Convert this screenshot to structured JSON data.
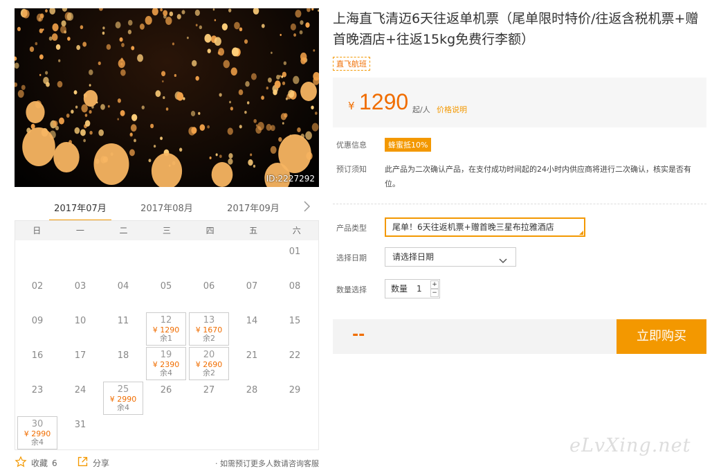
{
  "hero": {
    "id_label": "ID:2227292"
  },
  "calendar": {
    "months": [
      "2017年07月",
      "2017年08月",
      "2017年09月"
    ],
    "active_month": 0,
    "weekdays": [
      "日",
      "一",
      "二",
      "三",
      "四",
      "五",
      "六"
    ],
    "first_weekday": 6,
    "days_in_month": 31,
    "available": {
      "12": {
        "price": "¥ 1290",
        "remain": "余1"
      },
      "13": {
        "price": "¥ 1670",
        "remain": "余2"
      },
      "19": {
        "price": "¥ 2390",
        "remain": "余4"
      },
      "20": {
        "price": "¥ 2690",
        "remain": "余2"
      },
      "25": {
        "price": "¥ 2990",
        "remain": "余4"
      },
      "30": {
        "price": "¥ 2990",
        "remain": "余4"
      }
    }
  },
  "actions": {
    "favorite_label": "收藏",
    "favorite_count": "6",
    "share_label": "分享",
    "more_note": "· 如需预订更多人数请咨询客服"
  },
  "product": {
    "title": "上海直飞清迈6天往返单机票（尾单限时特价/往返含税机票+赠首晚酒店+往返15kg免费行李额）",
    "tag": "直飞航班",
    "price_symbol": "¥",
    "price": "1290",
    "price_unit": "起/人",
    "price_explain": "价格说明"
  },
  "info": {
    "discount_label": "优惠信息",
    "discount_badge": "蜂蜜抵10%",
    "notice_label": "预订须知",
    "notice_text": "此产品为二次确认产品，在支付成功时间起的24小时内供应商将进行二次确认，核实是否有位。"
  },
  "form": {
    "type_label": "产品类型",
    "type_value": "尾单！6天往返机票+赠首晚三星布拉雅酒店",
    "date_label": "选择日期",
    "date_value": "请选择日期",
    "qty_label": "数量选择",
    "qty_inner_label": "数量",
    "qty_value": "1",
    "plus": "+",
    "minus": "−"
  },
  "buy": {
    "total": "--",
    "button": "立即购买"
  },
  "watermark": "eLvXing.net",
  "colors": {
    "accent": "#f39800",
    "price": "#f06d00"
  }
}
